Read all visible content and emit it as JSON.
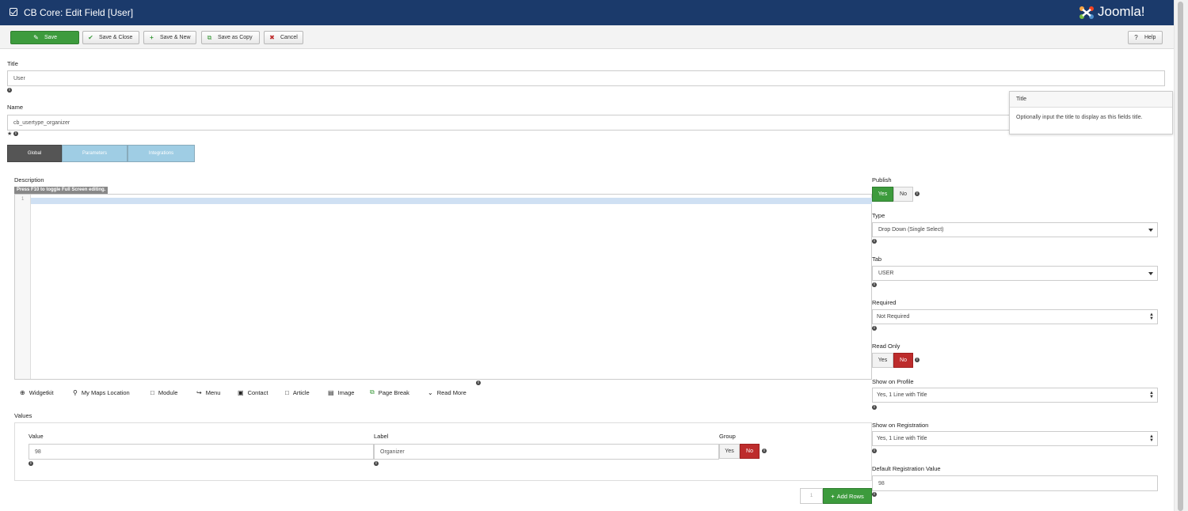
{
  "header": {
    "title": "CB Core: Edit Field [User]",
    "brand": "Joomla!"
  },
  "toolbar": {
    "save": "Save",
    "save_close": "Save & Close",
    "save_new": "Save & New",
    "save_copy": "Save as Copy",
    "cancel": "Cancel",
    "help": "Help"
  },
  "fields": {
    "title_label": "Title",
    "title_value": "User",
    "name_label": "Name",
    "name_value": "cb_usertype_organizer"
  },
  "tooltip": {
    "title": "Title",
    "body": "Optionally input the title to display as this fields title."
  },
  "tabs": [
    "Global",
    "Parameters",
    "Integrations"
  ],
  "description": {
    "label": "Description",
    "hint": "Press F10 to toggle Full Screen editing.",
    "line_number": "1"
  },
  "editor_buttons": [
    "Widgetkit",
    "My Maps Location",
    "Module",
    "Menu",
    "Contact",
    "Article",
    "Image",
    "Page Break",
    "Read More"
  ],
  "values": {
    "label": "Values",
    "col_value": "Value",
    "col_label": "Label",
    "col_group": "Group",
    "row_value": "98",
    "row_label": "Organizer",
    "group_yes": "Yes",
    "group_no": "No",
    "rows_count": "1",
    "add_rows": "Add Rows"
  },
  "right": {
    "publish_label": "Publish",
    "publish_yes": "Yes",
    "publish_no": "No",
    "type_label": "Type",
    "type_value": "Drop Down (Single Select)",
    "tab_label": "Tab",
    "tab_value": "USER",
    "required_label": "Required",
    "required_value": "Not Required",
    "readonly_label": "Read Only",
    "readonly_yes": "Yes",
    "readonly_no": "No",
    "show_profile_label": "Show on Profile",
    "show_profile_value": "Yes, 1 Line with Title",
    "show_reg_label": "Show on Registration",
    "show_reg_value": "Yes, 1 Line with Title",
    "default_reg_label": "Default Registration Value",
    "default_reg_value": "98"
  },
  "colors": {
    "header": "#1b3a6b",
    "green": "#3d9b3d",
    "red": "#bd2c2c",
    "tab_light": "#9fcde4"
  }
}
